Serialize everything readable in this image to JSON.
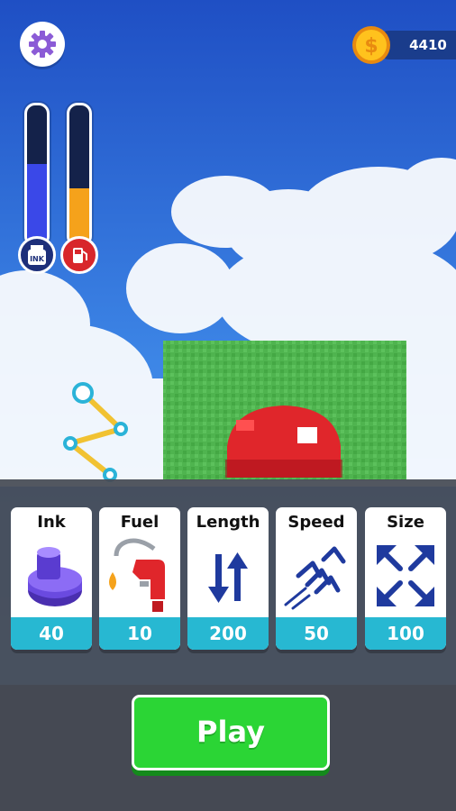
{
  "hud": {
    "coins": "4410",
    "ink_label": "INK",
    "ink_level": 0.58,
    "fuel_level": 0.4
  },
  "upgrades": [
    {
      "title": "Ink",
      "value": "40",
      "icon": "ink-bottle-icon"
    },
    {
      "title": "Fuel",
      "value": "10",
      "icon": "fuel-nozzle-icon"
    },
    {
      "title": "Length",
      "value": "200",
      "icon": "up-down-arrows-icon"
    },
    {
      "title": "Speed",
      "value": "50",
      "icon": "speed-lines-icon"
    },
    {
      "title": "Size",
      "value": "100",
      "icon": "expand-arrows-icon"
    }
  ],
  "play_label": "Play",
  "colors": {
    "sky": "#2f6fd9",
    "ink_fill": "#3a48e8",
    "fuel_fill": "#f5a21b",
    "card_value_bg": "#27b8d2",
    "play_button": "#2bd535",
    "button_target": "#e0262b",
    "grass": "#4fb44f"
  }
}
